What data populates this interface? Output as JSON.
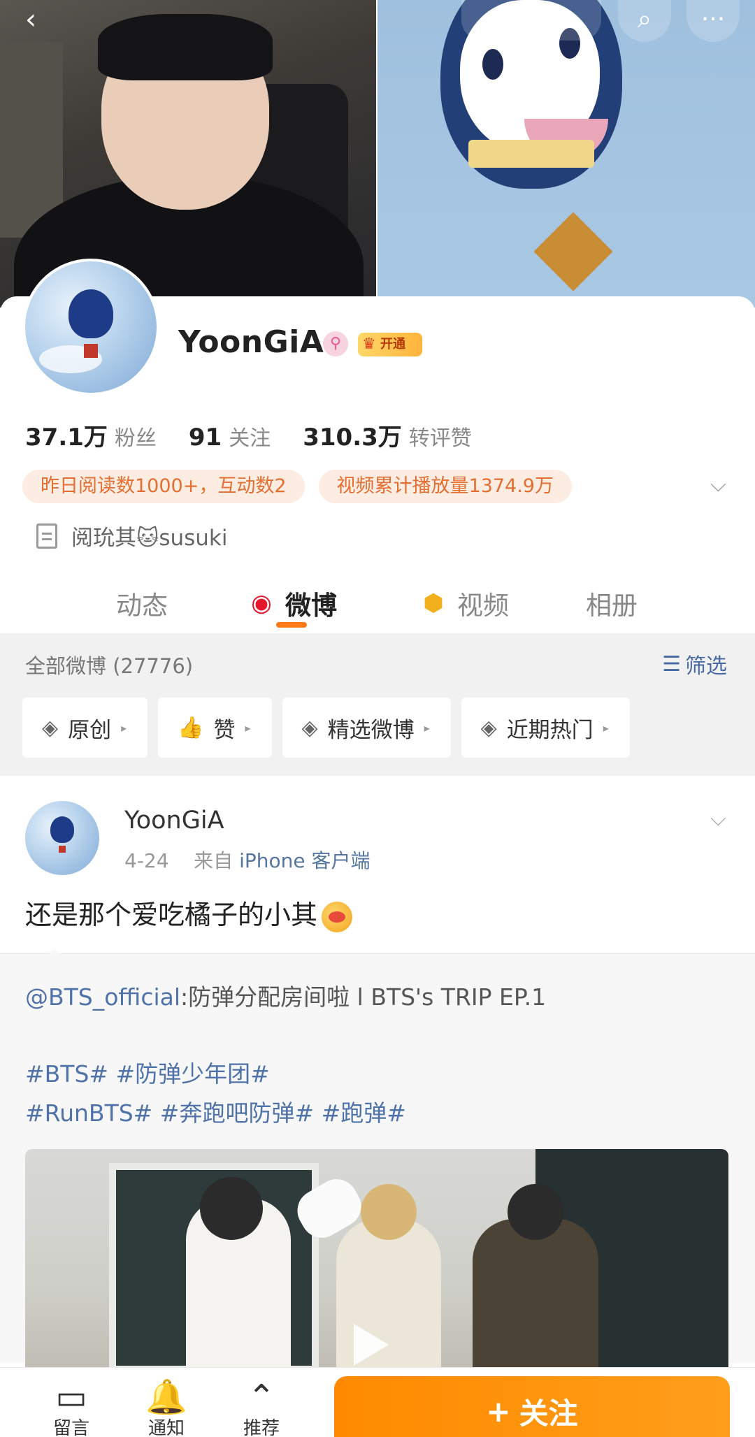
{
  "topbar": {
    "back_icon": "chevron-left-icon",
    "search_icon": "search-icon",
    "more_icon": "more-icon",
    "back_glyph": "‹",
    "search_glyph": "⌕",
    "more_glyph": "···"
  },
  "profile": {
    "name": "YoonGiA",
    "verify_glyph": "⚲",
    "vip_label": "开通",
    "stats": [
      {
        "num": "37.1万",
        "label": "粉丝"
      },
      {
        "num": "91",
        "label": "关注"
      },
      {
        "num": "310.3万",
        "label": "转评赞"
      }
    ],
    "chips": [
      "昨日阅读数1000+，互动数2",
      "视频累计播放量1374.9万"
    ],
    "bio": "阅玧其🐱susuki"
  },
  "tabs": [
    {
      "label": "动态"
    },
    {
      "label": "微博"
    },
    {
      "label": "视频"
    },
    {
      "label": "相册"
    }
  ],
  "feed_filter": {
    "title": "全部微博 (27776)",
    "filter_label": "筛选",
    "pills": [
      "原创",
      "赞",
      "精选微博",
      "近期热门"
    ]
  },
  "post": {
    "author": "YoonGiA",
    "date": "4-24",
    "from": "来自",
    "source": "iPhone 客户端",
    "text": "还是那个爱吃橘子的小其",
    "repost_mention": "@BTS_official",
    "repost_text": ":防弹分配房间啦 l BTS's TRIP EP.1",
    "tags_line1": "#BTS# #防弹少年团#",
    "tags_line2": "#RunBTS# #奔跑吧防弹# #跑弹#"
  },
  "bottom_bar": {
    "items": [
      {
        "label": "留言",
        "icon": "chat-bubble-icon",
        "glyph": "▭"
      },
      {
        "label": "通知",
        "icon": "bell-plus-icon",
        "glyph": "🔔"
      },
      {
        "label": "推荐",
        "icon": "chevron-up-circle-icon",
        "glyph": "⌃"
      }
    ],
    "follow_label": "关注",
    "follow_plus": "+"
  },
  "colors": {
    "accent_orange": "#ff8a00",
    "link_blue": "#4f73a8",
    "chip_text": "#e36f32"
  }
}
